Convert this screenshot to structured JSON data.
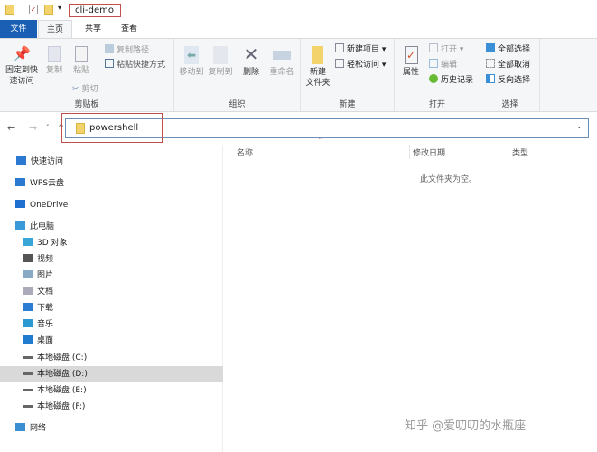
{
  "title": "cli-demo",
  "tabs": [
    "文件",
    "主页",
    "共享",
    "查看"
  ],
  "ribbon": {
    "clipboard": {
      "pin": [
        "固定到快",
        "速访问"
      ],
      "copy": "复制",
      "paste": "粘贴",
      "copy_path": "复制路径",
      "paste_shortcut": "粘贴快捷方式",
      "cut": "剪切",
      "label": "剪贴板"
    },
    "organize": {
      "move_to": "移动到",
      "copy_to": "复制到",
      "delete": "删除",
      "rename": "重命名",
      "label": "组织"
    },
    "new": {
      "new_folder": [
        "新建",
        "文件夹"
      ],
      "new_item": "新建项目 ▾",
      "easy_access": "轻松访问 ▾",
      "label": "新建"
    },
    "open": {
      "properties": "属性",
      "open": "打开 ▾",
      "edit": "编辑",
      "history": "历史记录",
      "label": "打开"
    },
    "select": {
      "select_all": "全部选择",
      "select_none": "全部取消",
      "invert": "反向选择",
      "label": "选择"
    }
  },
  "address": {
    "value": "powershell"
  },
  "columns": [
    "名称",
    "修改日期",
    "类型"
  ],
  "empty_message": "此文件夹为空。",
  "sidebar": [
    {
      "label": "快速访问",
      "icon": "star-icon",
      "color": "#2b79d0"
    },
    {
      "label": "WPS云盘",
      "icon": "cloud-icon",
      "color": "#2b79d0"
    },
    {
      "label": "OneDrive",
      "icon": "cloud-icon",
      "color": "#1e6fd0"
    },
    {
      "label": "此电脑",
      "icon": "computer-icon",
      "color": "#3a9ad9"
    },
    {
      "label": "3D 对象",
      "icon": "cube-icon",
      "color": "#3aa6d8"
    },
    {
      "label": "视频",
      "icon": "video-icon",
      "color": "#555"
    },
    {
      "label": "图片",
      "icon": "picture-icon",
      "color": "#8aa9c4"
    },
    {
      "label": "文档",
      "icon": "document-icon",
      "color": "#aab"
    },
    {
      "label": "下载",
      "icon": "download-icon",
      "color": "#2b7cd3"
    },
    {
      "label": "音乐",
      "icon": "music-icon",
      "color": "#2b9ad3"
    },
    {
      "label": "桌面",
      "icon": "desktop-icon",
      "color": "#1f7ccf"
    },
    {
      "label": "本地磁盘 (C:)",
      "icon": "drive-icon",
      "color": "#666"
    },
    {
      "label": "本地磁盘 (D:)",
      "icon": "drive-icon",
      "color": "#666",
      "selected": true
    },
    {
      "label": "本地磁盘 (E:)",
      "icon": "drive-icon",
      "color": "#666"
    },
    {
      "label": "本地磁盘 (F:)",
      "icon": "drive-icon",
      "color": "#666"
    },
    {
      "label": "网络",
      "icon": "network-icon",
      "color": "#3a8fd3"
    }
  ],
  "watermark": "知乎 @爱叨叨的水瓶座",
  "colors": {
    "file_tab": "#1a5fb4",
    "highlight_box": "#c0504d",
    "selection": "#d9d9d9"
  }
}
